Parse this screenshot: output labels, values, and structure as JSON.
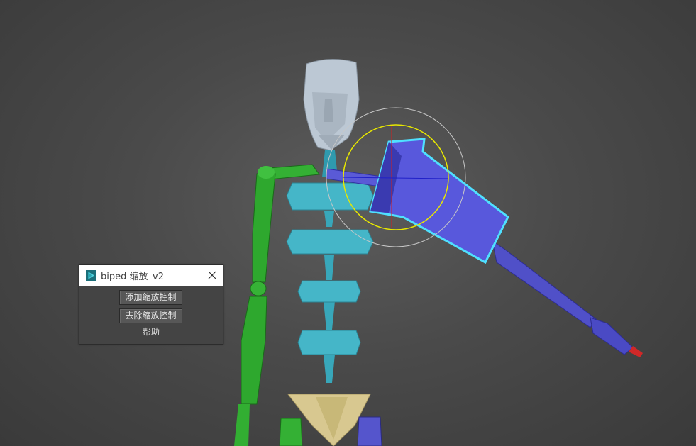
{
  "dialog": {
    "title": "biped 缩放_v2",
    "add_button_label": "添加缩放控制",
    "remove_button_label": "去除缩放控制",
    "help_label": "帮助",
    "app_icon": "3dsmax-icon",
    "close_icon": "close-icon"
  },
  "viewport": {
    "background_color": "#4a4a4a",
    "colors": {
      "head": "#b8c4d0",
      "spine": "#3aa8bb",
      "left_arm": "#2fa82f",
      "right_arm": "#5252c8",
      "pelvis": "#d8c890",
      "selection_outline": "#4fe0ff",
      "gizmo_circle": "#e8e800",
      "gizmo_outer": "#c8c8c8",
      "gizmo_axis_x": "#d02020",
      "gizmo_axis_z": "#2020c8"
    }
  }
}
